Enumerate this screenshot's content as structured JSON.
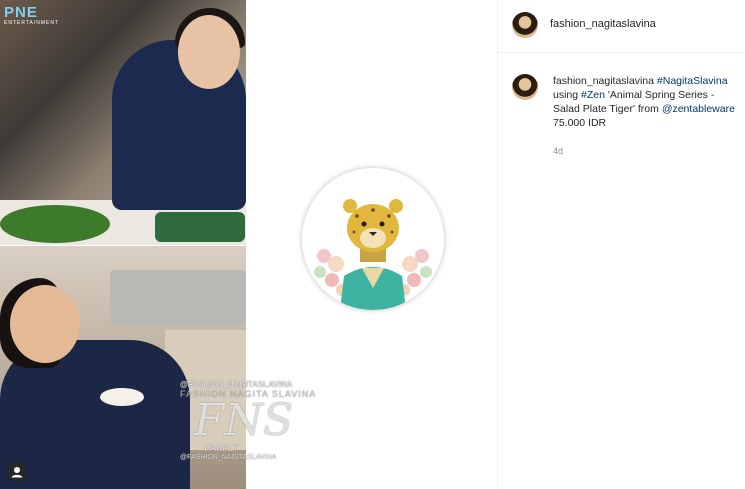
{
  "photo": {
    "brand_logo": {
      "main": "PNE",
      "sub": "ENTERTAINMENT"
    },
    "watermark": {
      "line1": "@FASHION_NAGITASLAVINA",
      "line2": "FASHION NAGITA SLAVINA",
      "monogram": "FNS",
      "line4": "FAMILY",
      "line5": "@FASHION_NAGITASLAVINA"
    }
  },
  "post": {
    "username": "fashion_nagitaslavina",
    "caption": {
      "username": "fashion_nagitaslavina",
      "hashtag1": "#NagitaSlavina",
      "text1": " using ",
      "hashtag2": "#Zen",
      "text2": " 'Animal Spring Series - Salad Plate Tiger' from ",
      "mention": "@zentableware",
      "text3": " 75.000 IDR"
    },
    "time": "4d"
  },
  "colors": {
    "link": "#00376b",
    "text": "#262626",
    "muted": "#8e8e8e"
  },
  "icons": [
    "user-tag-icon"
  ]
}
